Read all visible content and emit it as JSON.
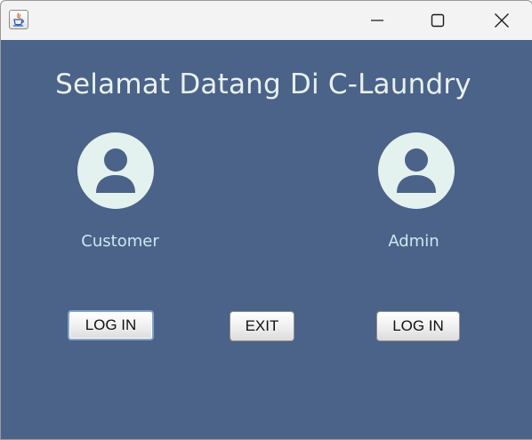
{
  "window": {
    "app_icon": "java-cup-icon",
    "controls": {
      "minimize": "minimize-icon",
      "maximize": "maximize-icon",
      "close": "close-icon"
    }
  },
  "main": {
    "title": "Selamat Datang Di C-Laundry",
    "customer": {
      "label": "Customer",
      "icon": "user-avatar-icon",
      "button_label": "LOG IN"
    },
    "admin": {
      "label": "Admin",
      "icon": "user-avatar-icon",
      "button_label": "LOG IN"
    },
    "exit_label": "EXIT"
  },
  "colors": {
    "background": "#4b6289",
    "title_text": "#e8f1ef",
    "label_text": "#cfe6f2",
    "avatar_fill": "#e3f2ee",
    "avatar_figure": "#4b6289"
  }
}
